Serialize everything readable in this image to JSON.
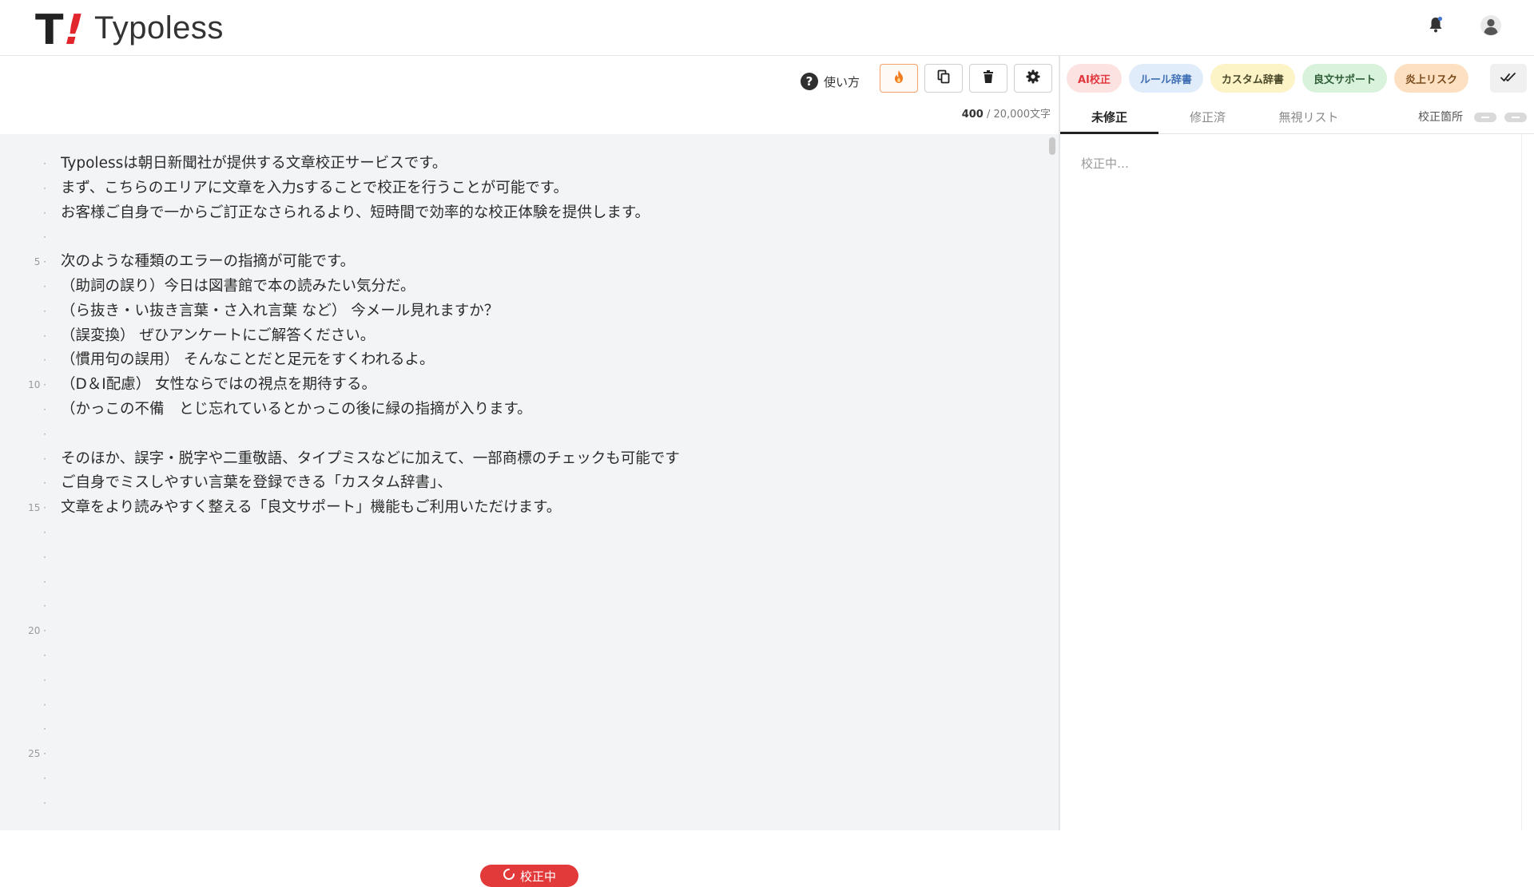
{
  "app": {
    "name": "Typoless"
  },
  "toolbar": {
    "help_label": "使い方",
    "char_count_current": "400",
    "char_count_max": "/ 20,000文字"
  },
  "editor": {
    "lines": [
      {
        "num": "·",
        "text": "Typolessは朝日新聞社が提供する文章校正サービスです。"
      },
      {
        "num": "·",
        "text": "まず、こちらのエリアに文章を入力sすることで校正を行うことが可能です。"
      },
      {
        "num": "·",
        "text": "お客様ご自身で一からご訂正なさられるより、短時間で効率的な校正体験を提供します。"
      },
      {
        "num": "·",
        "text": ""
      },
      {
        "num": "5 ·",
        "text": "次のような種類のエラーの指摘が可能です。"
      },
      {
        "num": "·",
        "text": "（助詞の誤り）今日は図書館で本の読みたい気分だ。"
      },
      {
        "num": "·",
        "text": "（ら抜き・い抜き言葉・さ入れ言葉 など） 今メール見れますか？"
      },
      {
        "num": "·",
        "text": "（誤変換） ぜひアンケートにご解答ください。"
      },
      {
        "num": "·",
        "text": "（慣用句の誤用） そんなことだと足元をすくわれるよ。"
      },
      {
        "num": "10 ·",
        "text": "（D＆I配慮） 女性ならではの視点を期待する。"
      },
      {
        "num": "·",
        "text": "（かっこの不備　とじ忘れているとかっこの後に緑の指摘が入ります。"
      },
      {
        "num": "·",
        "text": ""
      },
      {
        "num": "·",
        "text": "そのほか、誤字・脱字や二重敬語、タイプミスなどに加えて、一部商標のチェックも可能です"
      },
      {
        "num": "·",
        "text": "ご自身でミスしやすい言葉を登録できる「カスタム辞書」、"
      },
      {
        "num": "15 ·",
        "text": "文章をより読みやすく整える「良文サポート」機能もご利用いただけます。"
      },
      {
        "num": "·",
        "text": ""
      },
      {
        "num": "·",
        "text": ""
      },
      {
        "num": "·",
        "text": ""
      },
      {
        "num": "·",
        "text": ""
      },
      {
        "num": "20 ·",
        "text": ""
      },
      {
        "num": "·",
        "text": ""
      },
      {
        "num": "·",
        "text": ""
      },
      {
        "num": "·",
        "text": ""
      },
      {
        "num": "·",
        "text": ""
      },
      {
        "num": "25 ·",
        "text": ""
      },
      {
        "num": "·",
        "text": ""
      },
      {
        "num": "·",
        "text": ""
      }
    ],
    "status_label": "校正中"
  },
  "features": [
    {
      "label": "AI校正",
      "bg": "#fde2e2",
      "fg": "#e0383e"
    },
    {
      "label": "ルール辞書",
      "bg": "#e1ecfa",
      "fg": "#3f6fb5"
    },
    {
      "label": "カスタム辞書",
      "bg": "#fcf3c6",
      "fg": "#4a4a2a"
    },
    {
      "label": "良文サポート",
      "bg": "#d8f2dc",
      "fg": "#2f5d36"
    },
    {
      "label": "炎上リスク",
      "bg": "#fde0c2",
      "fg": "#7a4a1a"
    }
  ],
  "tabs": [
    {
      "label": "未修正",
      "active": true
    },
    {
      "label": "修正済",
      "active": false
    },
    {
      "label": "無視リスト",
      "active": false
    }
  ],
  "results": {
    "points_label": "校正箇所",
    "status": "校正中…"
  }
}
